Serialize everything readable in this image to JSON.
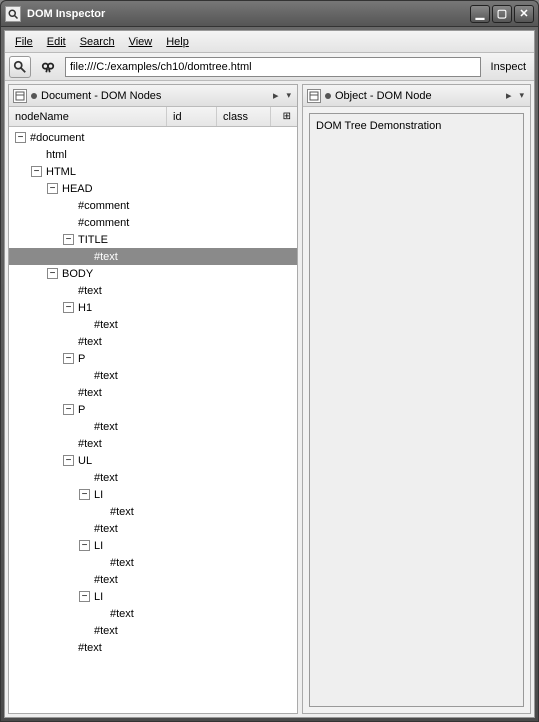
{
  "window": {
    "title": "DOM Inspector"
  },
  "menu": {
    "file": "File",
    "edit": "Edit",
    "search": "Search",
    "view": "View",
    "help": "Help"
  },
  "toolbar": {
    "url": "file:///C:/examples/ch10/domtree.html",
    "inspect": "Inspect"
  },
  "left_panel": {
    "title": "Document - DOM Nodes",
    "columns": {
      "node": "nodeName",
      "id": "id",
      "class": "class"
    }
  },
  "right_panel": {
    "title": "Object - DOM Node",
    "content": "DOM Tree Demonstration"
  },
  "tree": [
    {
      "depth": 0,
      "twist": "minus",
      "label": "#document",
      "sel": false
    },
    {
      "depth": 1,
      "twist": "none",
      "label": "html",
      "sel": false
    },
    {
      "depth": 1,
      "twist": "minus",
      "label": "HTML",
      "sel": false
    },
    {
      "depth": 2,
      "twist": "minus",
      "label": "HEAD",
      "sel": false
    },
    {
      "depth": 3,
      "twist": "none",
      "label": "#comment",
      "sel": false
    },
    {
      "depth": 3,
      "twist": "none",
      "label": "#comment",
      "sel": false
    },
    {
      "depth": 3,
      "twist": "minus",
      "label": "TITLE",
      "sel": false
    },
    {
      "depth": 4,
      "twist": "none",
      "label": "#text",
      "sel": true
    },
    {
      "depth": 2,
      "twist": "minus",
      "label": "BODY",
      "sel": false
    },
    {
      "depth": 3,
      "twist": "none",
      "label": "#text",
      "sel": false
    },
    {
      "depth": 3,
      "twist": "minus",
      "label": "H1",
      "sel": false
    },
    {
      "depth": 4,
      "twist": "none",
      "label": "#text",
      "sel": false
    },
    {
      "depth": 3,
      "twist": "none",
      "label": "#text",
      "sel": false
    },
    {
      "depth": 3,
      "twist": "minus",
      "label": "P",
      "sel": false
    },
    {
      "depth": 4,
      "twist": "none",
      "label": "#text",
      "sel": false
    },
    {
      "depth": 3,
      "twist": "none",
      "label": "#text",
      "sel": false
    },
    {
      "depth": 3,
      "twist": "minus",
      "label": "P",
      "sel": false
    },
    {
      "depth": 4,
      "twist": "none",
      "label": "#text",
      "sel": false
    },
    {
      "depth": 3,
      "twist": "none",
      "label": "#text",
      "sel": false
    },
    {
      "depth": 3,
      "twist": "minus",
      "label": "UL",
      "sel": false
    },
    {
      "depth": 4,
      "twist": "none",
      "label": "#text",
      "sel": false
    },
    {
      "depth": 4,
      "twist": "minus",
      "label": "LI",
      "sel": false
    },
    {
      "depth": 5,
      "twist": "none",
      "label": "#text",
      "sel": false
    },
    {
      "depth": 4,
      "twist": "none",
      "label": "#text",
      "sel": false
    },
    {
      "depth": 4,
      "twist": "minus",
      "label": "LI",
      "sel": false
    },
    {
      "depth": 5,
      "twist": "none",
      "label": "#text",
      "sel": false
    },
    {
      "depth": 4,
      "twist": "none",
      "label": "#text",
      "sel": false
    },
    {
      "depth": 4,
      "twist": "minus",
      "label": "LI",
      "sel": false
    },
    {
      "depth": 5,
      "twist": "none",
      "label": "#text",
      "sel": false
    },
    {
      "depth": 4,
      "twist": "none",
      "label": "#text",
      "sel": false
    },
    {
      "depth": 3,
      "twist": "none",
      "label": "#text",
      "sel": false
    }
  ]
}
